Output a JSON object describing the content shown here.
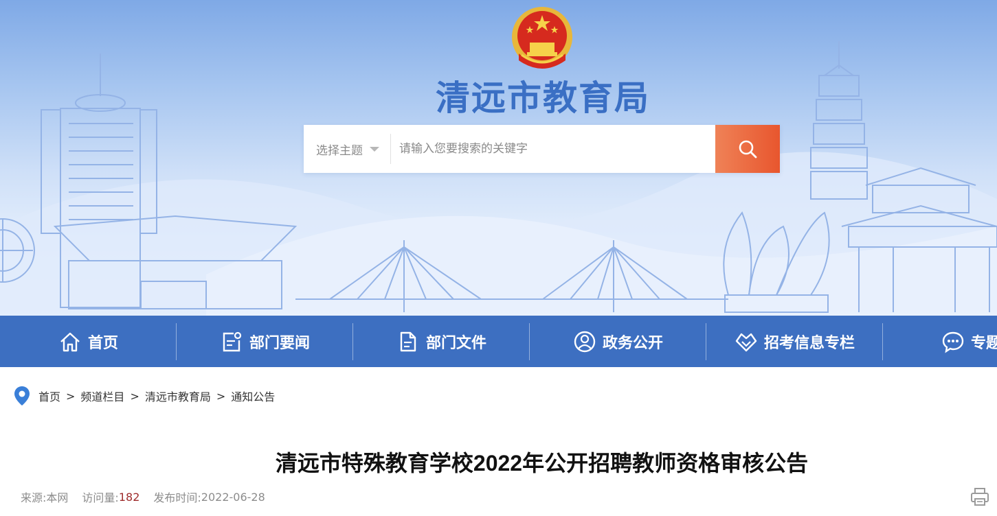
{
  "header": {
    "site_title": "清远市教育局",
    "search": {
      "topic_label": "选择主题",
      "placeholder": "请输入您要搜索的关键字",
      "button_icon": "search-icon"
    }
  },
  "nav": {
    "items": [
      {
        "label": "首页",
        "icon": "home-icon"
      },
      {
        "label": "部门要闻",
        "icon": "news-icon"
      },
      {
        "label": "部门文件",
        "icon": "document-icon"
      },
      {
        "label": "政务公开",
        "icon": "user-circle-icon"
      },
      {
        "label": "招考信息专栏",
        "icon": "heart-badge-icon"
      },
      {
        "label": "专题",
        "icon": "chat-icon"
      }
    ]
  },
  "breadcrumb": {
    "items": [
      "首页",
      "频道栏目",
      "清远市教育局",
      "通知公告"
    ],
    "separator": ">"
  },
  "article": {
    "title": "清远市特殊教育学校2022年公开招聘教师资格审核公告",
    "source_label": "来源:",
    "source_value": "本网",
    "views_label": "访问量:",
    "views_value": "182",
    "date_label": "发布时间:",
    "date_value": "2022-06-28"
  },
  "colors": {
    "nav_bg": "#3d6fc1",
    "title_blue": "#3a6fc4",
    "search_button": "#e8562e",
    "views_accent": "#9e2b2b"
  }
}
